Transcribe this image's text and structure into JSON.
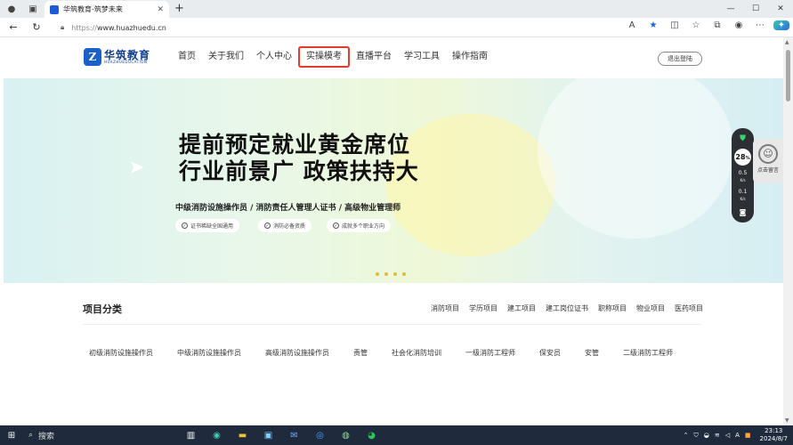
{
  "browser": {
    "tab_title": "华筑教育-筑梦未来",
    "url_protocol": "https://",
    "url_host": "www.huazhuedu.cn"
  },
  "header": {
    "logo_cn": "华筑教育",
    "logo_en": "HUAZHUEDUCATION",
    "nav": [
      "首页",
      "关于我们",
      "个人中心",
      "实操模考",
      "直播平台",
      "学习工具",
      "操作指南"
    ],
    "active_nav_index": 3,
    "logout": "退出登陆"
  },
  "banner": {
    "headline_1": "提前预定就业黄金席位",
    "headline_2": "行业前景广 政策扶持大",
    "subline": "中级消防设施操作员 / 消防责任人管理人证书 / 高级物业管理师",
    "pills": [
      "证书稀缺全国通用",
      "消防必备资质",
      "成就多个职业方向"
    ],
    "slide_count": 4
  },
  "speed_widget": {
    "percent": "28",
    "percent_unit": "%",
    "up": "0.5",
    "down": "0.1",
    "unit": "K/s"
  },
  "service": {
    "label": "点击留言"
  },
  "category": {
    "title": "项目分类",
    "links": [
      "消防项目",
      "学历项目",
      "建工项目",
      "建工岗位证书",
      "职称项目",
      "物业项目",
      "医药项目"
    ],
    "courses": [
      "初级消防设施操作员",
      "中级消防设施操作员",
      "高级消防设施操作员",
      "责管",
      "社会化消防培训",
      "一级消防工程师",
      "保安员",
      "安管",
      "二级消防工程师"
    ]
  },
  "taskbar": {
    "search_label": "搜索",
    "time": "23:13",
    "date": "2024/8/7",
    "ime": "A"
  },
  "colors": {
    "accent_blue": "#1960c8",
    "active_border": "#e43b2b",
    "taskbar": "#1f2a3c"
  }
}
